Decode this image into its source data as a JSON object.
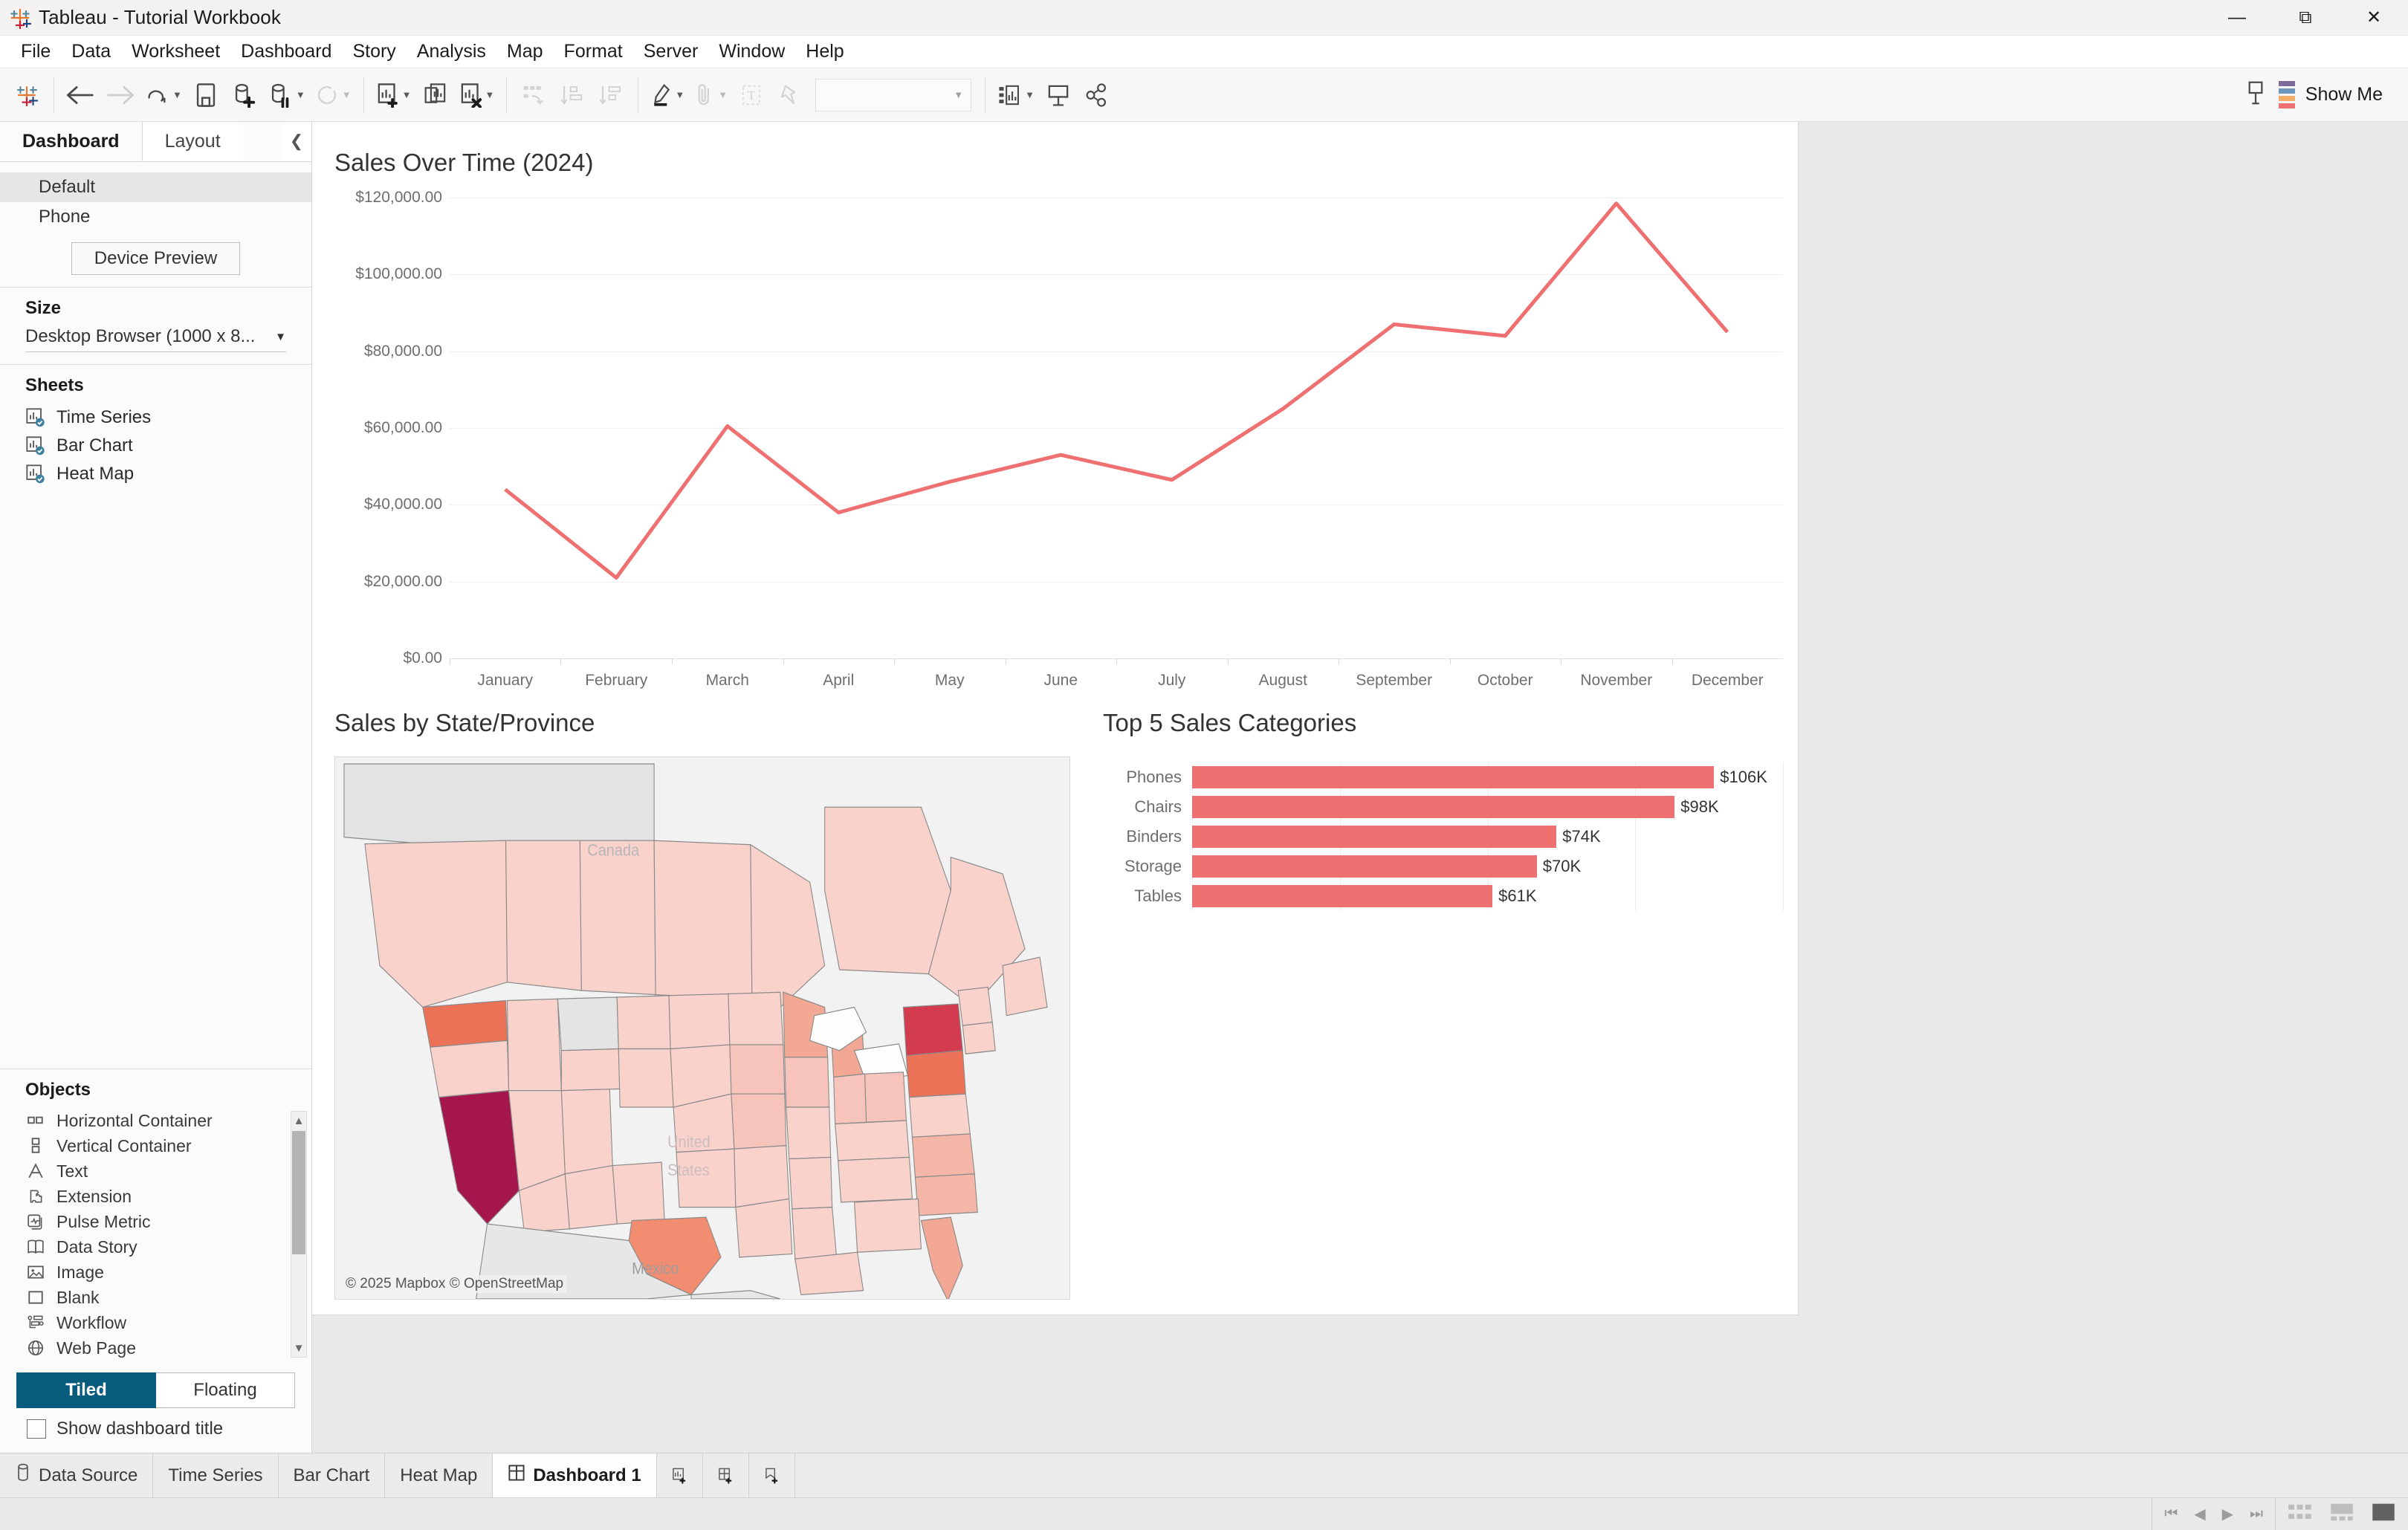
{
  "window": {
    "title": "Tableau - Tutorial Workbook",
    "logo_icon": "tableau-logo-icon",
    "minimize_icon": "minimize-icon",
    "restore_icon": "restore-icon",
    "close_icon": "close-icon"
  },
  "menu": {
    "items": [
      "File",
      "Data",
      "Worksheet",
      "Dashboard",
      "Story",
      "Analysis",
      "Map",
      "Format",
      "Server",
      "Window",
      "Help"
    ]
  },
  "toolbar": {
    "buttons": [
      {
        "name": "tableau-home-icon",
        "label": ""
      },
      {
        "name": "back-arrow-icon",
        "label": ""
      },
      {
        "name": "forward-arrow-icon",
        "label": ""
      },
      {
        "name": "undo-redo-icon",
        "label": ""
      },
      {
        "name": "save-icon",
        "label": ""
      },
      {
        "name": "add-data-source-icon",
        "label": ""
      },
      {
        "name": "pause-auto-update-icon",
        "label": ""
      },
      {
        "name": "refresh-icon",
        "label": ""
      },
      {
        "name": "new-worksheet-icon",
        "label": ""
      },
      {
        "name": "duplicate-sheet-icon",
        "label": ""
      },
      {
        "name": "clear-sheet-icon",
        "label": ""
      },
      {
        "name": "swap-rows-columns-icon",
        "label": ""
      },
      {
        "name": "sort-ascending-icon",
        "label": ""
      },
      {
        "name": "sort-descending-icon",
        "label": ""
      },
      {
        "name": "highlight-icon",
        "label": ""
      },
      {
        "name": "attachment-icon",
        "label": ""
      },
      {
        "name": "text-box-icon",
        "label": ""
      },
      {
        "name": "pin-icon",
        "label": ""
      },
      {
        "name": "fit-selector",
        "label": ""
      },
      {
        "name": "show-hide-cards-icon",
        "label": ""
      },
      {
        "name": "presentation-mode-icon",
        "label": ""
      },
      {
        "name": "share-icon",
        "label": ""
      },
      {
        "name": "device-preview-icon",
        "label": ""
      }
    ],
    "fit_selector_value": "",
    "show_me_label": "Show Me",
    "show_me_icon": "show-me-icon"
  },
  "left_pane": {
    "tabs": [
      {
        "label": "Dashboard",
        "active": true
      },
      {
        "label": "Layout",
        "active": false
      }
    ],
    "collapse_icon": "chevron-left-icon",
    "device_layouts": [
      {
        "label": "Default",
        "selected": true
      },
      {
        "label": "Phone",
        "selected": false
      }
    ],
    "device_preview_button": "Device Preview",
    "size": {
      "heading": "Size",
      "value": "Desktop Browser (1000 x 8...",
      "caret_icon": "chevron-down-icon"
    },
    "sheets": {
      "heading": "Sheets",
      "items": [
        {
          "label": "Time Series",
          "icon": "worksheet-used-icon"
        },
        {
          "label": "Bar Chart",
          "icon": "worksheet-used-icon"
        },
        {
          "label": "Heat Map",
          "icon": "worksheet-used-icon"
        }
      ]
    },
    "objects": {
      "heading": "Objects",
      "items": [
        {
          "label": "Horizontal Container",
          "icon": "horizontal-container-icon"
        },
        {
          "label": "Vertical Container",
          "icon": "vertical-container-icon"
        },
        {
          "label": "Text",
          "icon": "text-object-icon"
        },
        {
          "label": "Extension",
          "icon": "extension-icon"
        },
        {
          "label": "Pulse Metric",
          "icon": "pulse-metric-icon"
        },
        {
          "label": "Data Story",
          "icon": "data-story-icon"
        },
        {
          "label": "Image",
          "icon": "image-icon"
        },
        {
          "label": "Blank",
          "icon": "blank-icon"
        },
        {
          "label": "Workflow",
          "icon": "workflow-icon"
        },
        {
          "label": "Web Page",
          "icon": "web-page-icon"
        }
      ],
      "scroll_up_icon": "scroll-up-arrow-icon",
      "scroll_down_icon": "scroll-down-arrow-icon"
    },
    "tiled_floating": {
      "tiled": "Tiled",
      "floating": "Floating",
      "active": "Tiled"
    },
    "show_dashboard_title": {
      "label": "Show dashboard title",
      "checked": false
    }
  },
  "dashboard": {
    "line_chart_title": "Sales Over Time (2024)",
    "map_title": "Sales by State/Province",
    "bar_chart_title": "Top 5 Sales Categories",
    "map_attribution": "© 2025 Mapbox © OpenStreetMap",
    "map_labels": [
      "Canada",
      "United",
      "States",
      "Mexico"
    ],
    "accent_color": "#ef7071",
    "map_max_color": "#a5174c",
    "map_min_color": "#fbd9d2"
  },
  "chart_data": [
    {
      "type": "line",
      "title": "Sales Over Time (2024)",
      "xlabel": "",
      "ylabel": "",
      "categories": [
        "January",
        "February",
        "March",
        "April",
        "May",
        "June",
        "July",
        "August",
        "September",
        "October",
        "November",
        "December"
      ],
      "series": [
        {
          "name": "Sales",
          "values": [
            44000,
            21000,
            60500,
            38000,
            46000,
            53000,
            46500,
            65000,
            87000,
            84000,
            118500,
            85000
          ],
          "color": "#ef7071"
        }
      ],
      "ytick_labels": [
        "$120,000.00",
        "$100,000.00",
        "$80,000.00",
        "$60,000.00",
        "$40,000.00",
        "$20,000.00",
        "$0.00"
      ],
      "ytick_values": [
        120000,
        100000,
        80000,
        60000,
        40000,
        20000,
        0
      ],
      "ylim": [
        0,
        120000
      ],
      "grid": true,
      "legend": "none"
    },
    {
      "type": "bar",
      "title": "Top 5 Sales Categories",
      "orientation": "horizontal",
      "categories": [
        "Phones",
        "Chairs",
        "Binders",
        "Storage",
        "Tables"
      ],
      "values": [
        106,
        98,
        74,
        70,
        61
      ],
      "value_labels": [
        "$106K",
        "$98K",
        "$74K",
        "$70K",
        "$61K"
      ],
      "unit": "thousand USD",
      "xlim": [
        0,
        120
      ],
      "grid": true,
      "legend": "none",
      "color": "#ef7071"
    },
    {
      "type": "heatmap",
      "subtype": "choropleth-map",
      "title": "Sales by State/Province",
      "region": "North America",
      "legend": "none",
      "highlights": [
        {
          "region": "California",
          "level": "highest",
          "color": "#a5174c"
        },
        {
          "region": "New York",
          "level": "very-high",
          "color": "#d33b4e"
        },
        {
          "region": "Washington",
          "level": "high",
          "color": "#ec7257"
        },
        {
          "region": "Pennsylvania",
          "level": "high",
          "color": "#ee7a5e"
        },
        {
          "region": "Texas",
          "level": "medium-high",
          "color": "#f28d72"
        },
        {
          "region": "Wyoming",
          "level": "no-data",
          "color": "#e2e2e2"
        }
      ]
    }
  ],
  "sheet_tabs": {
    "data_source": {
      "label": "Data Source",
      "icon": "data-source-icon"
    },
    "tabs": [
      {
        "label": "Time Series",
        "active": false
      },
      {
        "label": "Bar Chart",
        "active": false
      },
      {
        "label": "Heat Map",
        "active": false
      },
      {
        "label": "Dashboard 1",
        "active": true,
        "icon": "dashboard-icon"
      }
    ],
    "new_buttons": [
      {
        "name": "new-worksheet-tab-icon"
      },
      {
        "name": "new-dashboard-tab-icon"
      },
      {
        "name": "new-story-tab-icon"
      }
    ]
  },
  "status_bar": {
    "nav_icons": [
      "first-page-icon",
      "previous-page-icon",
      "next-page-icon",
      "last-page-icon"
    ],
    "view_icons": [
      "grid-view-icon",
      "filmstrip-view-icon",
      "single-view-icon"
    ]
  }
}
